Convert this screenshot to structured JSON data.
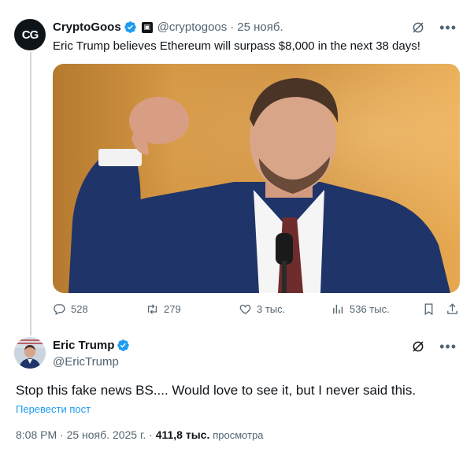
{
  "tweet1": {
    "avatar_text": "CG",
    "name": "CryptoGoos",
    "handle": "@cryptogoos",
    "separator": "·",
    "time": "25 нояб.",
    "text": "Eric Trump believes Ethereum will surpass $8,000 in the next 38 days!",
    "stats": {
      "replies": "528",
      "reposts": "279",
      "likes": "3 тыс.",
      "views": "536 тыс."
    }
  },
  "tweet2": {
    "name": "Eric Trump",
    "handle": "@EricTrump",
    "text": "Stop this fake news BS.... Would love to see it, but I never said this.",
    "translate": "Перевести пост",
    "time": "8:08 PM · 25 нояб. 2025 г. ·",
    "views_count": "411,8 тыс.",
    "views_label": "просмотра"
  },
  "colors": {
    "verified": "#1d9bf0",
    "secondary_text": "#536471",
    "link": "#1d9bf0"
  },
  "icons": [
    "verified-badge-icon",
    "affiliate-badge-icon",
    "grok-icon",
    "more-icon",
    "reply-icon",
    "repost-icon",
    "like-icon",
    "views-icon",
    "bookmark-icon",
    "share-icon"
  ]
}
